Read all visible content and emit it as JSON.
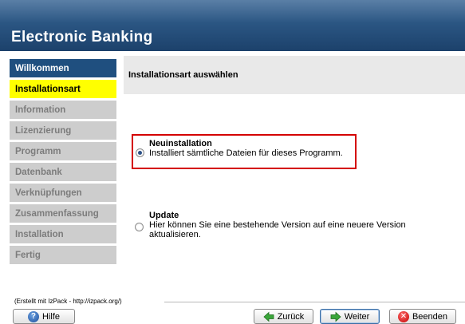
{
  "app": {
    "title": "Electronic Banking"
  },
  "sidebar": {
    "items": [
      {
        "label": "Willkommen",
        "state": "done"
      },
      {
        "label": "Installationsart",
        "state": "active"
      },
      {
        "label": "Information",
        "state": "pending"
      },
      {
        "label": "Lizenzierung",
        "state": "pending"
      },
      {
        "label": "Programm",
        "state": "pending"
      },
      {
        "label": "Datenbank",
        "state": "pending"
      },
      {
        "label": "Verknüpfungen",
        "state": "pending"
      },
      {
        "label": "Zusammenfassung",
        "state": "pending"
      },
      {
        "label": "Installation",
        "state": "pending"
      },
      {
        "label": "Fertig",
        "state": "pending"
      }
    ]
  },
  "main": {
    "heading": "Installationsart auswählen",
    "options": {
      "new": {
        "title": "Neuinstallation",
        "description": "Installiert sämtliche Dateien für dieses Programm.",
        "selected": true
      },
      "update": {
        "title": "Update",
        "description_line1": "Hier können Sie eine bestehende Version auf eine neuere Version",
        "description_line2": "aktualisieren.",
        "selected": false
      }
    }
  },
  "footer": {
    "credit": "(Erstellt mit IzPack - http://izpack.org/)",
    "buttons": {
      "help": "Hilfe",
      "back": "Zurück",
      "next": "Weiter",
      "quit": "Beenden"
    }
  },
  "colors": {
    "header": "#1c416b",
    "nav_done": "#1f4f7f",
    "nav_active": "#ffff00",
    "nav_pending": "#cdcdcd",
    "highlight": "#d40000",
    "back_arrow": "#3aa63a",
    "next_arrow": "#3aa63a"
  },
  "icons": {
    "help": "help-circle-icon",
    "back": "arrow-left-icon",
    "next": "arrow-right-icon",
    "quit": "close-circle-icon"
  }
}
